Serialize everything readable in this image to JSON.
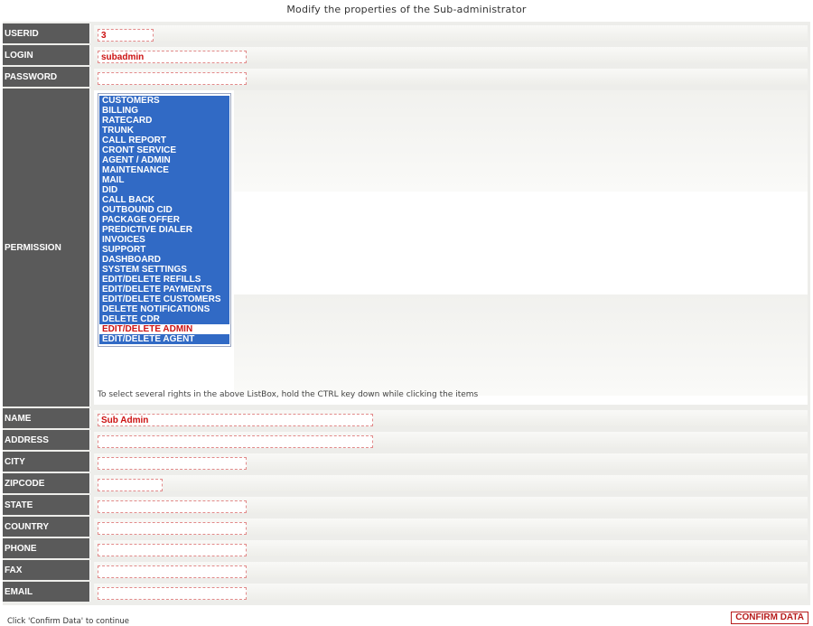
{
  "page": {
    "title": "Modify the properties of the Sub-administrator",
    "footer_note": "Click 'Confirm Data' to continue",
    "confirm_label": "CONFIRM DATA"
  },
  "fields": {
    "userid": {
      "label": "USERID",
      "value": "3"
    },
    "login": {
      "label": "LOGIN",
      "value": "subadmin"
    },
    "password": {
      "label": "PASSWORD",
      "value": ""
    },
    "permission": {
      "label": "PERMISSION"
    },
    "name": {
      "label": "NAME",
      "value": "Sub Admin"
    },
    "address": {
      "label": "ADDRESS",
      "value": ""
    },
    "city": {
      "label": "CITY",
      "value": ""
    },
    "zipcode": {
      "label": "ZIPCODE",
      "value": ""
    },
    "state": {
      "label": "STATE",
      "value": ""
    },
    "country": {
      "label": "COUNTRY",
      "value": ""
    },
    "phone": {
      "label": "PHONE",
      "value": ""
    },
    "fax": {
      "label": "FAX",
      "value": ""
    },
    "email": {
      "label": "EMAIL",
      "value": ""
    }
  },
  "permissions": {
    "hint": "To select several rights in the above ListBox, hold the CTRL key down while clicking the items",
    "options": [
      {
        "label": "CUSTOMERS",
        "selected": true
      },
      {
        "label": "BILLING",
        "selected": true
      },
      {
        "label": "RATECARD",
        "selected": true
      },
      {
        "label": "TRUNK",
        "selected": true
      },
      {
        "label": "CALL REPORT",
        "selected": true
      },
      {
        "label": "CRONT SERVICE",
        "selected": true
      },
      {
        "label": "AGENT / ADMIN",
        "selected": true
      },
      {
        "label": "MAINTENANCE",
        "selected": true
      },
      {
        "label": "MAIL",
        "selected": true
      },
      {
        "label": "DID",
        "selected": true
      },
      {
        "label": "CALL BACK",
        "selected": true
      },
      {
        "label": "OUTBOUND CID",
        "selected": true
      },
      {
        "label": "PACKAGE OFFER",
        "selected": true
      },
      {
        "label": "PREDICTIVE DIALER",
        "selected": true
      },
      {
        "label": "INVOICES",
        "selected": true
      },
      {
        "label": "SUPPORT",
        "selected": true
      },
      {
        "label": "DASHBOARD",
        "selected": true
      },
      {
        "label": "SYSTEM SETTINGS",
        "selected": true
      },
      {
        "label": "EDIT/DELETE REFILLS",
        "selected": true
      },
      {
        "label": "EDIT/DELETE PAYMENTS",
        "selected": true
      },
      {
        "label": "EDIT/DELETE CUSTOMERS",
        "selected": true
      },
      {
        "label": "DELETE NOTIFICATIONS",
        "selected": true
      },
      {
        "label": "DELETE CDR",
        "selected": true
      },
      {
        "label": "EDIT/DELETE ADMIN",
        "selected": false
      },
      {
        "label": "EDIT/DELETE AGENT",
        "selected": true
      }
    ]
  },
  "colors": {
    "label_bg": "#5a5a5a",
    "selected_bg": "#316ac5",
    "input_text": "#cc1111",
    "input_border": "#e28a8a",
    "button_border": "#b71c1c"
  }
}
